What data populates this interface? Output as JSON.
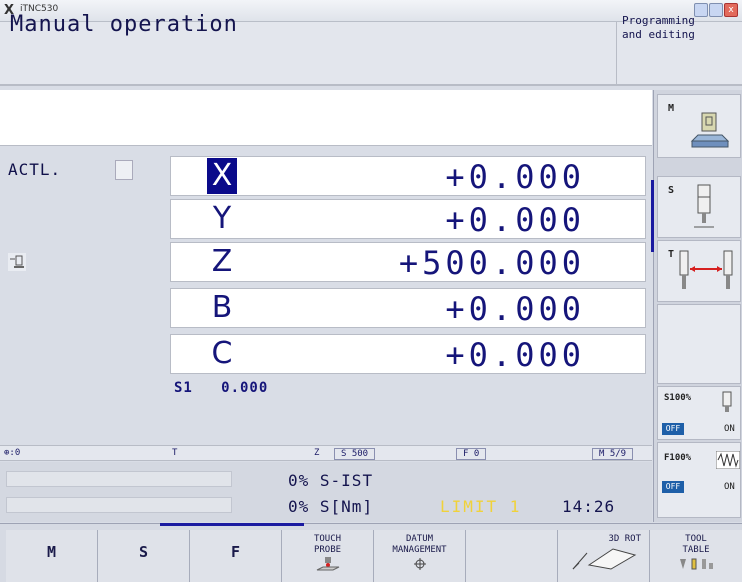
{
  "window": {
    "title": "iTNC530",
    "logo": "X",
    "close_glyph": "x"
  },
  "header": {
    "mode": "Manual operation",
    "secondary_mode": "Programming\nand editing"
  },
  "position": {
    "display_mode": "ACTL.",
    "axes": [
      {
        "axis": "X",
        "value": "+0.000",
        "active": true
      },
      {
        "axis": "Y",
        "value": "+0.000",
        "active": false
      },
      {
        "axis": "Z",
        "value": "+500.000",
        "active": false
      },
      {
        "axis": "B",
        "value": "+0.000",
        "active": false
      },
      {
        "axis": "C",
        "value": "+0.000",
        "active": false
      }
    ],
    "spindle": "S1   0.000"
  },
  "status_line": {
    "datum": "⊕:0",
    "tool": "T",
    "axis": "Z",
    "spindle_speed": "S 500",
    "feed": "F 0",
    "m_functions": "M 5/9"
  },
  "load": {
    "spindle_pct": "0%",
    "spindle_label": "S-IST",
    "torque_pct": "0%",
    "torque_label": "S[Nm]",
    "limit": "LIMIT 1",
    "time": "14:26"
  },
  "right_softkeys": [
    {
      "letter": "M",
      "icon": "machine-table-icon"
    },
    {
      "letter": "S",
      "icon": "spindle-icon"
    },
    {
      "letter": "T",
      "icon": "tool-measure-icon"
    },
    {
      "letter": "",
      "icon": ""
    },
    {
      "label": "S100%",
      "off": "OFF",
      "on": "ON"
    },
    {
      "label": "F100%",
      "off": "OFF",
      "on": "ON"
    }
  ],
  "colors": {
    "active_axis_bg": "#0a0a8a",
    "axis_text": "#15157a",
    "limit_text": "#f0d23a",
    "off_badge": "#1e5fa8"
  },
  "softkeys": [
    {
      "label": "M"
    },
    {
      "label": "S"
    },
    {
      "label": "F"
    },
    {
      "label": "TOUCH\nPROBE"
    },
    {
      "label": "DATUM\nMANAGEMENT"
    },
    {
      "label": ""
    },
    {
      "label": "3D ROT"
    },
    {
      "label": "TOOL\nTABLE"
    }
  ]
}
